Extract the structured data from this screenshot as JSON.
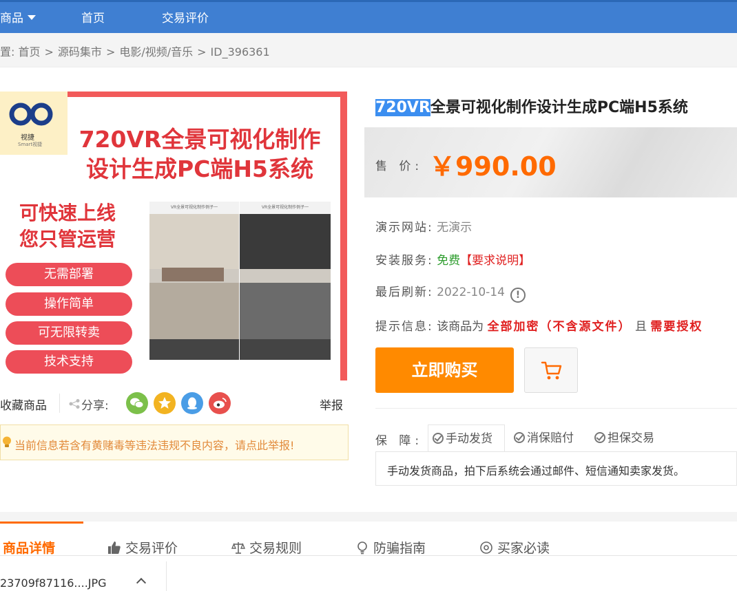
{
  "nav": {
    "items": [
      "商品",
      "首页",
      "交易评价"
    ]
  },
  "breadcrumb": {
    "prefix": "置:",
    "items": [
      "首页",
      "源码集市",
      "电影/视频/音乐",
      "ID_396361"
    ],
    "sep": ">"
  },
  "image": {
    "logo_name": "视捷",
    "logo_sub": "Smart视捷",
    "title_line1": "720VR全景可视化制作",
    "title_line2": "设计生成PC端H5系统",
    "slogan_line1": "可快速上线",
    "slogan_line2": "您只管运营",
    "pills": [
      "无需部署",
      "操作简单",
      "可无限转卖",
      "技术支持"
    ],
    "shot_title": "VR全景可视化制作例子一"
  },
  "actions": {
    "favorite": "收藏商品",
    "share": "分享:",
    "report": "举报",
    "share_icons": [
      "wechat-icon",
      "star-icon",
      "qq-icon",
      "weibo-icon"
    ]
  },
  "warning": "当前信息若含有黄赌毒等违法违规不良内容，请点此举报!",
  "product": {
    "title_highlight": "720VR",
    "title_rest": "全景可视化制作设计生成PC端H5系统",
    "price_label": "售 价:",
    "price": "￥990.00",
    "demo_label": "演示网站:",
    "demo_value": "无演示",
    "install_label": "安装服务:",
    "install_value": "免费",
    "install_link": "【要求说明】",
    "refresh_label": "最后刷新:",
    "refresh_value": "2022-10-14",
    "hint_label": "提示信息:",
    "hint_text1": "该商品为",
    "hint_red1": "全部加密（不含源文件）",
    "hint_text2": "且",
    "hint_red2": "需要授权",
    "buy_button": "立即购买"
  },
  "guarantee": {
    "label": "保 障:",
    "tabs": [
      "手动发货",
      "消保赔付",
      "担保交易"
    ],
    "desc": "手动发货商品，拍下后系统会通过邮件、短信通知卖家发货。"
  },
  "tabs": [
    "商品详情",
    "交易评价",
    "交易规则",
    "防骗指南",
    "买家必读"
  ],
  "file": {
    "name": "23709f87116....JPG"
  },
  "colors": {
    "nav": "#3f7fd2",
    "price": "#ff6a00",
    "buy": "#ff8a00",
    "alert": "#e02020"
  }
}
